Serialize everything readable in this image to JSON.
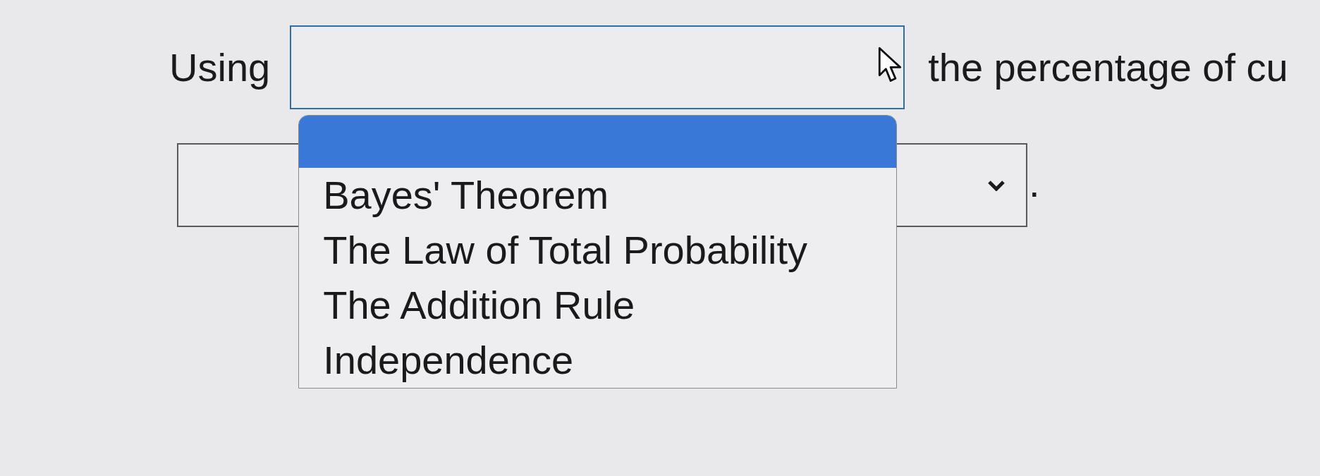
{
  "question": {
    "line_1": {
      "lead": "Using",
      "select": {
        "expanded": true,
        "blank_option": {
          "selected": true
        },
        "options": [
          {
            "label": "Bayes' Theorem",
            "selected": false
          },
          {
            "label": "The Law of Total Probability",
            "selected": false
          },
          {
            "label": "The Addition Rule",
            "selected": false
          },
          {
            "label": "Independence",
            "selected": false
          }
        ]
      },
      "trail": "the percentage of cu"
    },
    "line_2": {
      "select": {
        "expanded": false
      },
      "trail": "."
    }
  }
}
